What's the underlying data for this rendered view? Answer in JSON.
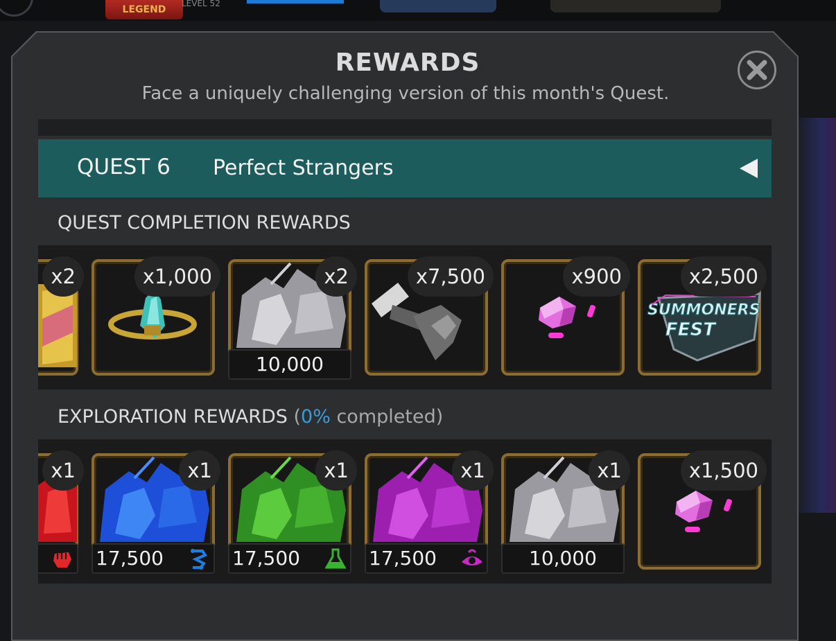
{
  "background": {
    "legend_label": "LEGEND",
    "level_text": "LEVEL 52"
  },
  "modal": {
    "title": "REWARDS",
    "subtitle": "Face a uniquely challenging version of this month's Quest.",
    "close_icon": "close-icon"
  },
  "quest": {
    "number": "QUEST 6",
    "name": "Perfect Strangers",
    "toggle_icon": "collapse-arrow-icon"
  },
  "completion": {
    "label": "QUEST COMPLETION REWARDS",
    "items": [
      {
        "icon": "gold-crystal-icon",
        "count": "x2"
      },
      {
        "icon": "crystal-ring-icon",
        "count": "x1,000"
      },
      {
        "icon": "silver-shard-crystal-icon",
        "count": "x2",
        "value": "10,000"
      },
      {
        "icon": "rank-up-sledgehammer-icon",
        "count": "x7,500"
      },
      {
        "icon": "unit-crystal-icon",
        "count": "x900"
      },
      {
        "icon": "summoners-fest-icon",
        "count": "x2,500",
        "logo_text": "SUMMONERS FEST"
      }
    ]
  },
  "exploration": {
    "label": "EXPLORATION REWARDS",
    "paren_open": " (",
    "percent": "0%",
    "paren_text": " completed)",
    "items": [
      {
        "icon": "red-fist-crystal-icon",
        "count": "x1",
        "class_icon": "mutant-fist-icon",
        "class_color": "#e0272a"
      },
      {
        "icon": "blue-shard-crystal-icon",
        "count": "x1",
        "value": "17,500",
        "class_icon": "tech-icon",
        "class_color": "#1f7fe0"
      },
      {
        "icon": "green-shard-crystal-icon",
        "count": "x1",
        "value": "17,500",
        "class_icon": "science-flask-icon",
        "class_color": "#37b52e"
      },
      {
        "icon": "purple-shard-crystal-icon",
        "count": "x1",
        "value": "17,500",
        "class_icon": "mystic-eye-icon",
        "class_color": "#c928c9"
      },
      {
        "icon": "silver-shard-crystal-icon",
        "count": "x1",
        "value": "10,000"
      },
      {
        "icon": "unit-crystal-icon",
        "count": "x1,500"
      }
    ]
  }
}
